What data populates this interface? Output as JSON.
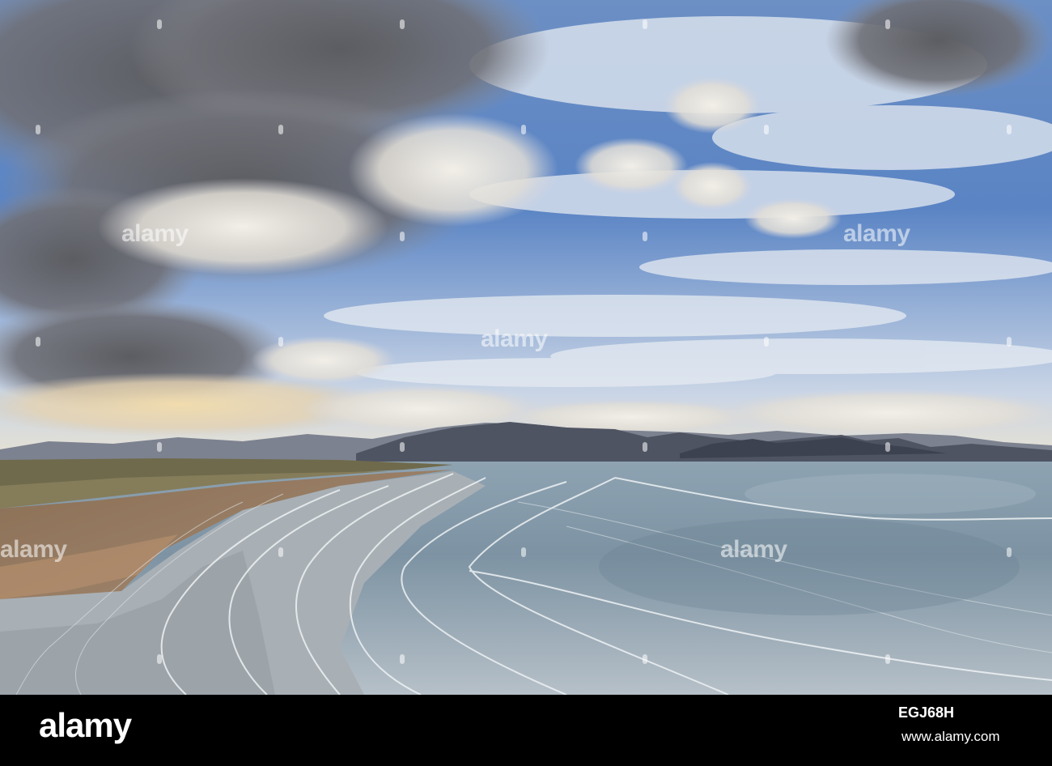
{
  "watermark": {
    "text": "alamy"
  },
  "footer": {
    "logo": "alamy",
    "image_id": "EGJ68H",
    "site": "www.alamy.com"
  }
}
